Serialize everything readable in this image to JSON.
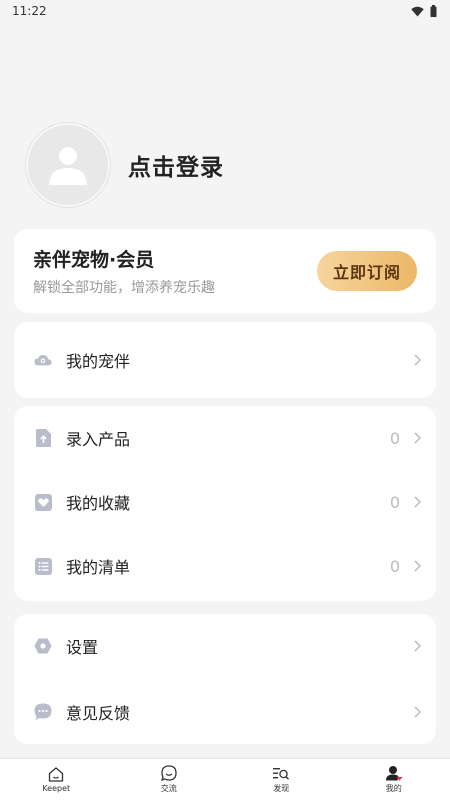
{
  "status_bar": {
    "time": "11:22",
    "icons": [
      "wifi-icon",
      "battery-icon"
    ]
  },
  "profile": {
    "login_text": "点击登录",
    "avatar_icon": "person-icon"
  },
  "vip": {
    "title": "亲伴宠物·会员",
    "subtitle": "解锁全部功能，增添养宠乐趣",
    "button_label": "立即订阅"
  },
  "group1": {
    "items": [
      {
        "label": "我的宠伴",
        "icon": "pet-cloud-icon"
      }
    ]
  },
  "group2": {
    "items": [
      {
        "label": "录入产品",
        "count": "0",
        "icon": "upload-file-icon"
      },
      {
        "label": "我的收藏",
        "count": "0",
        "icon": "heart-icon"
      },
      {
        "label": "我的清单",
        "count": "0",
        "icon": "list-icon"
      }
    ]
  },
  "group3": {
    "items": [
      {
        "label": "设置",
        "icon": "settings-hexagon-icon"
      },
      {
        "label": "意见反馈",
        "icon": "chat-bubble-icon"
      }
    ]
  },
  "tabbar": {
    "tabs": [
      {
        "label": "Keepet",
        "icon": "home-icon"
      },
      {
        "label": "交流",
        "icon": "chat-icon"
      },
      {
        "label": "发现",
        "icon": "discover-search-icon"
      },
      {
        "label": "我的",
        "icon": "profile-icon",
        "active": true
      }
    ]
  },
  "colors": {
    "background": "#f4f4f4",
    "card": "#ffffff",
    "icon_gray": "#b9bccb",
    "vip_gold_start": "#f6d59d",
    "vip_gold_end": "#ebb867",
    "vip_text": "#5b3510",
    "accent_red": "#e8304a"
  }
}
